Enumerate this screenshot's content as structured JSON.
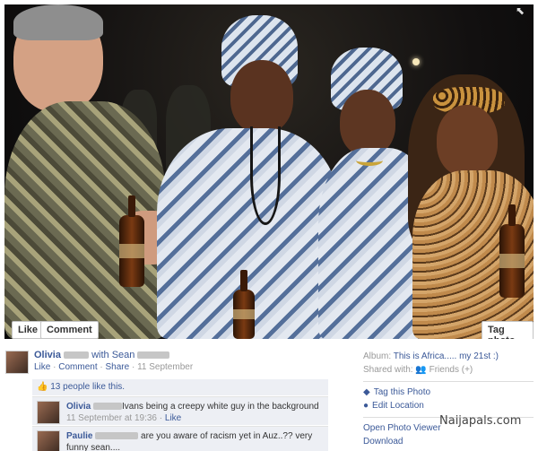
{
  "photo": {
    "like_label": "Like",
    "comment_label": "Comment",
    "tag_photo_label": "Tag photo"
  },
  "post": {
    "author": "Olivia",
    "with_text": "with Sean",
    "actions": [
      "Like",
      "Comment",
      "Share"
    ],
    "date": "11 September",
    "likes_text": "13 people like this."
  },
  "comments": [
    {
      "author": "Olivia",
      "text": "Ivans being a creepy white guy in the background",
      "time": "11 September at 19:36",
      "like_label": "Like"
    },
    {
      "author": "Paulie",
      "text": "are you aware of racism yet in Auz..?? very funny sean....",
      "time": "",
      "like_label": ""
    }
  ],
  "side": {
    "album_label": "Album:",
    "album_name": "This is Africa..... my 21st :)",
    "shared_label": "Shared with:",
    "shared_value": "Friends (+)",
    "tag_label": "Tag this Photo",
    "location_label": "Edit Location",
    "viewer_label": "Open Photo Viewer",
    "download_label": "Download"
  },
  "watermark": "Naijapals.com",
  "colors": {
    "link": "#3b5998",
    "comment_bg": "#edeff4"
  }
}
